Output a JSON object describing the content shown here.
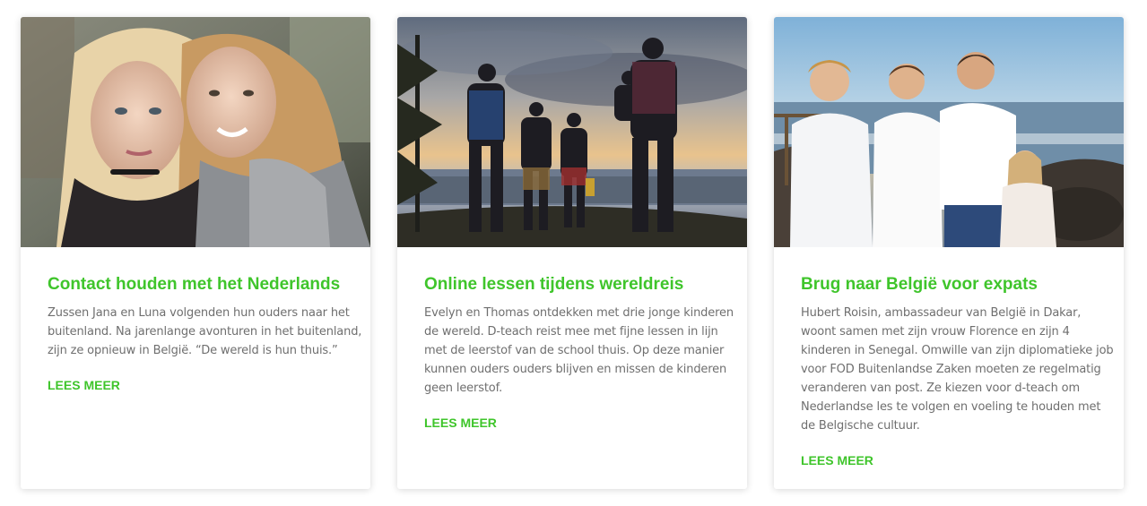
{
  "colors": {
    "accent": "#3fc52b",
    "body_text": "#6f6f6f",
    "card_background": "#ffffff"
  },
  "cards": [
    {
      "image_description": "two-sisters-photo",
      "title": "Contact houden met het Nederlands",
      "text_lines": [
        "Zussen Jana en Luna volgenden hun ouders naar het",
        "buitenland. Na jarenlange avonturen in het buitenland,",
        "zijn ze opnieuw in België. “De wereld is hun thuis.”"
      ],
      "link": "LEES MEER"
    },
    {
      "image_description": "family-on-hill-photo",
      "title": "Online lessen tijdens wereldreis",
      "text_lines": [
        "Evelyn en Thomas ontdekken met drie jonge kinderen",
        "de wereld. D-teach reist mee met fijne lessen in lijn",
        "met de leerstof van de school thuis. Op deze manier",
        "kunnen ouders ouders blijven en missen de kinderen",
        "geen leerstof."
      ],
      "link": "LEES MEER"
    },
    {
      "image_description": "children-at-sea-photo",
      "title": "Brug naar België voor expats",
      "text_lines": [
        "Hubert Roisin, ambassadeur van België in Dakar,",
        "woont samen met zijn vrouw Florence en zijn 4",
        "kinderen in Senegal. Omwille van zijn diplomatieke job",
        "voor FOD Buitenlandse Zaken moeten ze regelmatig",
        "veranderen van post. Ze kiezen voor d-teach om",
        "Nederlandse les te volgen en voeling te houden met",
        "de Belgische cultuur."
      ],
      "link": "LEES MEER"
    }
  ]
}
